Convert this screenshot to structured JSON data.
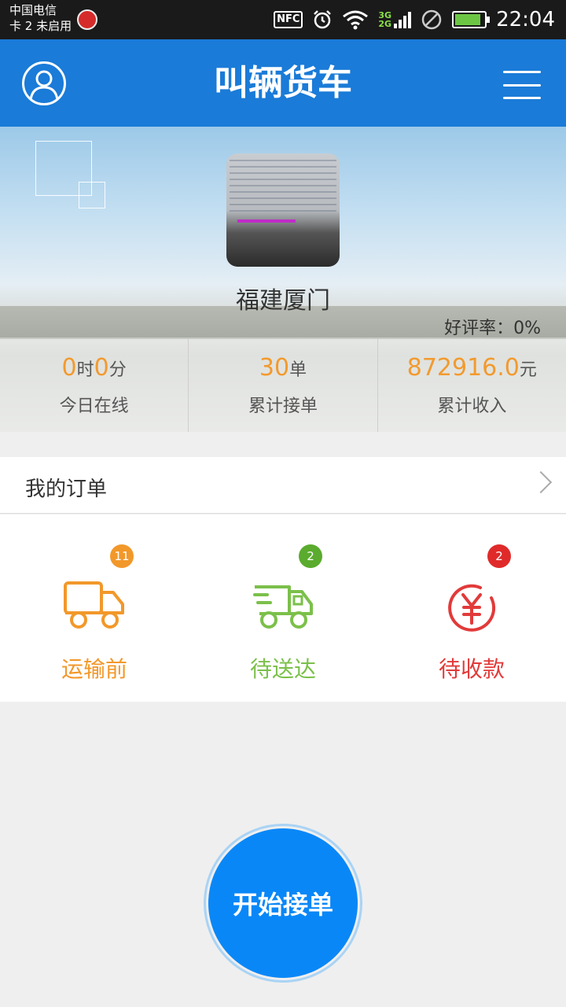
{
  "status_bar": {
    "carrier": "中国电信",
    "sim2": "卡 2 未启用",
    "nfc": "NFC",
    "net_3g": "3G",
    "net_2g": "2G",
    "time": "22:04",
    "battery_level": 0.9
  },
  "header": {
    "title": "叫辆货车"
  },
  "profile": {
    "location": "福建厦门",
    "rating_label": "好评率：",
    "rating_value": "0%"
  },
  "stats": {
    "online_hours": "0",
    "online_h_unit": "时",
    "online_minutes": "0",
    "online_m_unit": "分",
    "online_label": "今日在线",
    "orders_value": "30",
    "orders_unit": "单",
    "orders_label": "累计接单",
    "income_value": "872916.0",
    "income_unit": "元",
    "income_label": "累计收入"
  },
  "orders": {
    "title": "我的订单",
    "items": [
      {
        "label": "运输前",
        "badge": "11",
        "color": "#f2982a",
        "badge_color": "#f2982a",
        "icon": "truck-icon"
      },
      {
        "label": "待送达",
        "badge": "2",
        "color": "#7bc04a",
        "badge_color": "#5aab2e",
        "icon": "delivery-truck-icon"
      },
      {
        "label": "待收款",
        "badge": "2",
        "color": "#e23a3a",
        "badge_color": "#e02a2a",
        "icon": "yuan-icon"
      }
    ]
  },
  "start_button": {
    "label": "开始接单"
  }
}
